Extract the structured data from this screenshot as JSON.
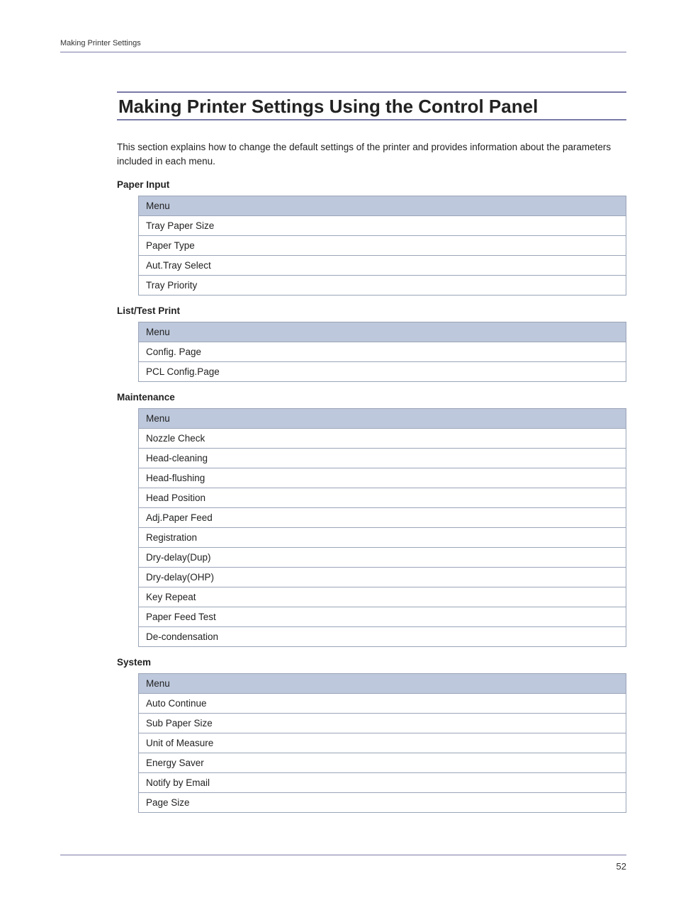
{
  "header": {
    "label": "Making Printer Settings"
  },
  "title": "Making Printer Settings Using the Control Panel",
  "intro": "This section explains how to change the default settings of the printer and provides information about the parameters included in each menu.",
  "sections": [
    {
      "heading": "Paper Input",
      "menu_header": "Menu",
      "items": [
        "Tray Paper Size",
        "Paper Type",
        "Aut.Tray Select",
        "Tray Priority"
      ]
    },
    {
      "heading": "List/Test Print",
      "menu_header": "Menu",
      "items": [
        "Config. Page",
        "PCL Config.Page"
      ]
    },
    {
      "heading": "Maintenance",
      "menu_header": "Menu",
      "items": [
        "Nozzle Check",
        "Head-cleaning",
        "Head-flushing",
        "Head Position",
        "Adj.Paper Feed",
        "Registration",
        "Dry-delay(Dup)",
        "Dry-delay(OHP)",
        "Key Repeat",
        "Paper Feed Test",
        "De-condensation"
      ]
    },
    {
      "heading": "System",
      "menu_header": "Menu",
      "items": [
        "Auto Continue",
        "Sub Paper Size",
        "Unit of Measure",
        "Energy Saver",
        "Notify by Email",
        "Page Size"
      ]
    }
  ],
  "page_number": "52"
}
